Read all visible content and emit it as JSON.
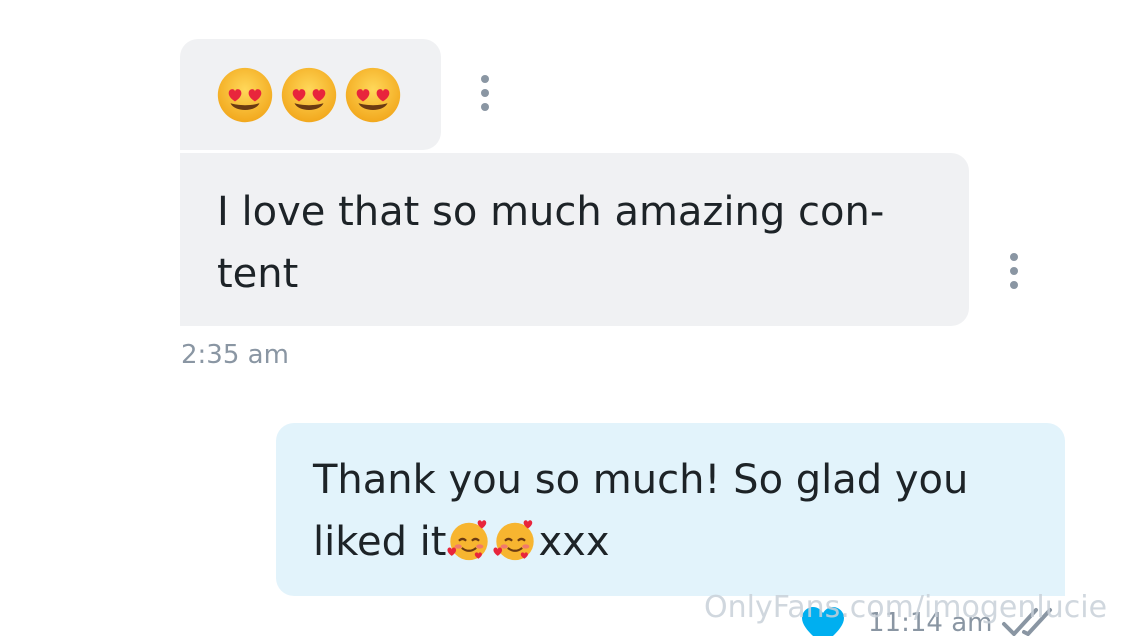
{
  "messages": {
    "incoming_emoji": {
      "emojis": [
        "heart-eyes-emoji",
        "heart-eyes-emoji",
        "heart-eyes-emoji"
      ]
    },
    "incoming_text": {
      "line1": "I love that so much amazing con-",
      "line2": "tent",
      "time": "2:35 am"
    },
    "outgoing_text": {
      "line1": "Thank you so much! So glad you",
      "line2_prefix": "liked it",
      "line2_emojis": [
        "smiling-face-with-hearts-emoji",
        "smiling-face-with-hearts-emoji"
      ],
      "line2_suffix": "xxx",
      "time": "11:14 am"
    }
  },
  "watermark": "OnlyFans.com/imogenlucie",
  "colors": {
    "incoming_bubble": "#f0f1f3",
    "outgoing_bubble": "#e2f3fb",
    "meta_gray": "#8a96a3",
    "text": "#1d2327",
    "accent_blue": "#00aff0"
  }
}
